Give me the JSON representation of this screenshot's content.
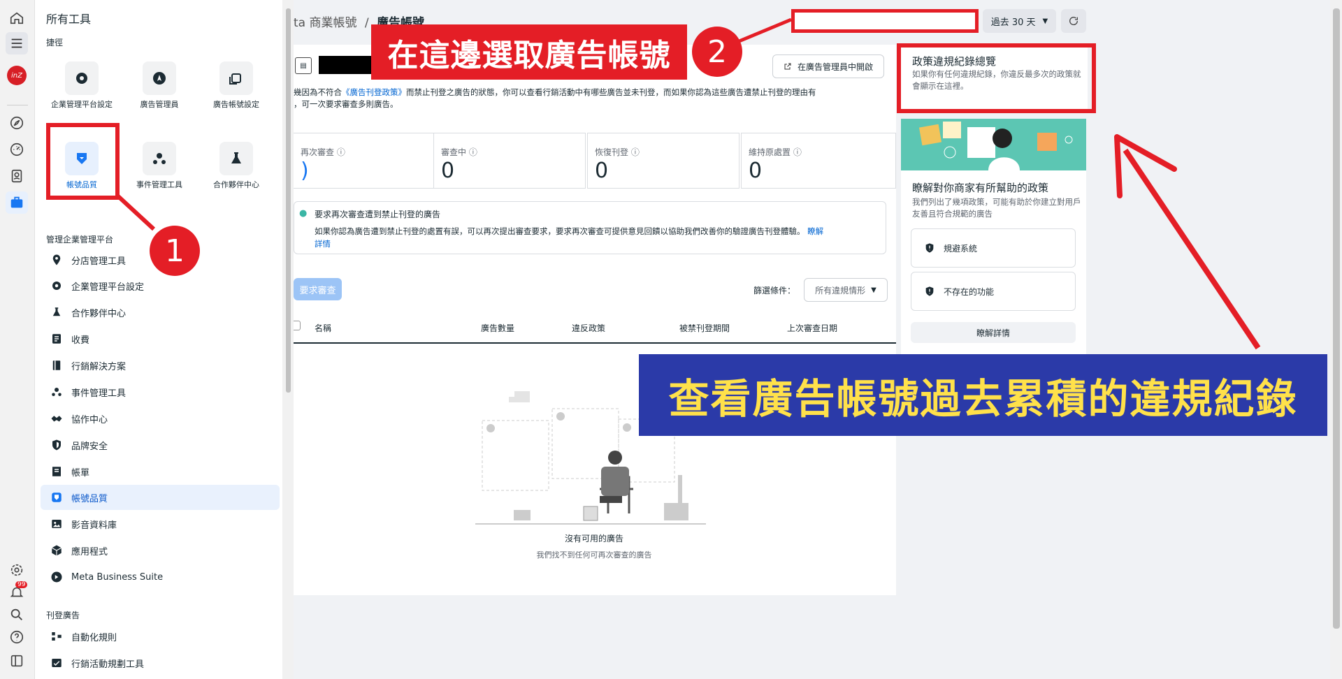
{
  "drawer": {
    "title": "所有工具",
    "shortcuts_label": "捷徑",
    "tiles": [
      {
        "label": "企業管理平台設定",
        "icon": "gear-icon"
      },
      {
        "label": "廣告管理員",
        "icon": "navigation-arrow-icon"
      },
      {
        "label": "廣告帳號設定",
        "icon": "ad-account-settings-icon"
      },
      {
        "label": "帳號品質",
        "icon": "shield-icon"
      },
      {
        "label": "事件管理工具",
        "icon": "events-nodes-icon"
      },
      {
        "label": "合作夥伴中心",
        "icon": "flask-icon"
      }
    ],
    "section_manage": "管理企業管理平台",
    "nav_items": [
      {
        "label": "分店管理工具",
        "icon": "location-pin-icon"
      },
      {
        "label": "企業管理平台設定",
        "icon": "gear-icon"
      },
      {
        "label": "合作夥伴中心",
        "icon": "flask-icon"
      },
      {
        "label": "收費",
        "icon": "receipt-icon"
      },
      {
        "label": "行銷解決方案",
        "icon": "book-icon"
      },
      {
        "label": "事件管理工具",
        "icon": "events-nodes-icon"
      },
      {
        "label": "協作中心",
        "icon": "handshake-icon"
      },
      {
        "label": "品牌安全",
        "icon": "shield-outline-icon"
      },
      {
        "label": "帳單",
        "icon": "invoice-icon"
      },
      {
        "label": "帳號品質",
        "icon": "shield-icon"
      },
      {
        "label": "影音資料庫",
        "icon": "media-library-icon"
      },
      {
        "label": "應用程式",
        "icon": "cube-icon"
      },
      {
        "label": "Meta Business Suite",
        "icon": "meta-suite-icon"
      }
    ],
    "section_ads": "刊登廣告",
    "ads_items": [
      {
        "label": "自動化規則",
        "icon": "automation-icon"
      },
      {
        "label": "行銷活動規劃工具",
        "icon": "planner-icon"
      }
    ]
  },
  "rail": {
    "notification_badge": "99"
  },
  "header": {
    "breadcrumb_parent": "ta 商業帳號",
    "breadcrumb_sep": "/",
    "breadcrumb_current": "廣告帳號",
    "date_range": "過去 30 天"
  },
  "main": {
    "open_in_ads_manager": "在廣告管理員中開啟",
    "description_pre": "幾因為不符合",
    "description_link": "《廣告刊登政策》",
    "description_post": "而禁止刊登之廣告的狀態，你可以查看行銷活動中有哪些廣告並未刊登，而如果你認為這些廣告遭禁止刊登的理由有",
    "description_line2": "，可一次要求審查多則廣告。",
    "stats": [
      {
        "label": "再次審查",
        "value": ")"
      },
      {
        "label": "審查中",
        "value": "0"
      },
      {
        "label": "恢復刊登",
        "value": "0"
      },
      {
        "label": "維持原處置",
        "value": "0"
      }
    ],
    "info_title": "要求再次審查遭到禁止刊登的廣告",
    "info_body": "如果你認為廣告遭到禁止刊登的處置有誤，可以再次提出審查要求，要求再次審查可提供意見回饋以協助我們改善你的驗證廣告刊登體驗。",
    "info_link_a": "瞭解",
    "info_link_b": "詳情",
    "request_review": "要求審查",
    "filter_label": "篩選條件：",
    "filter_value": "所有違規情形",
    "table_headers": [
      "名稱",
      "廣告數量",
      "違反政策",
      "被禁刊登期間",
      "上次審查日期"
    ],
    "empty_title": "沒有可用的廣告",
    "empty_subtitle": "我們找不到任何可再次審查的廣告"
  },
  "right_panel": {
    "overview_title": "政策違規紀錄總覽",
    "overview_desc": "如果你有任何違規紀錄，你違反最多次的政策就會顯示在這裡。",
    "card_title": "瞭解對你商家有所幫助的政策",
    "card_desc": "我們列出了幾項政策，可能有助於你建立對用戶友善且符合規範的廣告",
    "policies": [
      "規避系統",
      "不存在的功能"
    ],
    "learn_more": "瞭解詳情"
  },
  "annotations": {
    "select_account": "在這邊選取廣告帳號",
    "step1": "1",
    "step2": "2",
    "banner": "查看廣告帳號過去累積的違規紀錄"
  },
  "colors": {
    "annotation_red": "#e41e26",
    "annotation_blue": "#2b3aa8",
    "annotation_yellow": "#ffe14a",
    "accent_blue": "#1877f2"
  }
}
